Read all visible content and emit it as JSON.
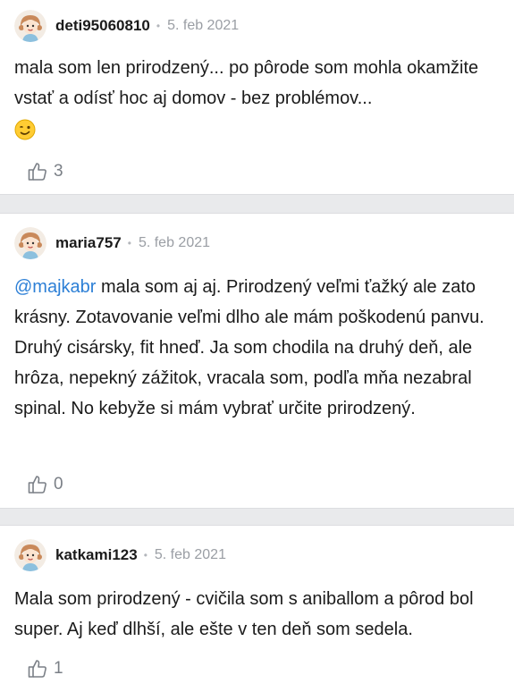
{
  "comments": [
    {
      "username": "deti95060810",
      "separator": "•",
      "date": "5. feb 2021",
      "text": "mala som len prirodzený... po pôrode som mohla okamžite vstať a odísť hoc aj domov - bez problémov...",
      "emoji": "winking-face",
      "likes": "3"
    },
    {
      "username": "maria757",
      "separator": "•",
      "date": "5. feb 2021",
      "mention": "@majkabr",
      "text": " mala som aj aj. Prirodzený veľmi ťažký ale zato krásny. Zotavovanie veľmi dlho ale mám poškodenú panvu. Druhý cisársky, fit hneď. Ja som chodila na druhý deň, ale hrôza, nepekný zážitok, vracala som, podľa mňa nezabral spinal. No kebyže si mám vybrať určite prirodzený.",
      "likes": "0"
    },
    {
      "username": "katkami123",
      "separator": "•",
      "date": "5. feb 2021",
      "text": "Mala som prirodzený - cvičila som s aniballom a pôrod bol super. Aj keď dlhší, ale ešte v ten deň som sedela.",
      "likes": "1"
    }
  ],
  "icons": {
    "avatar": "girl-avatar-icon",
    "like": "thumbs-up-icon"
  },
  "colors": {
    "mention": "#2c7fd6",
    "meta": "#9a9ea4",
    "text": "#1b1b1b",
    "background": "#e9eaec"
  }
}
